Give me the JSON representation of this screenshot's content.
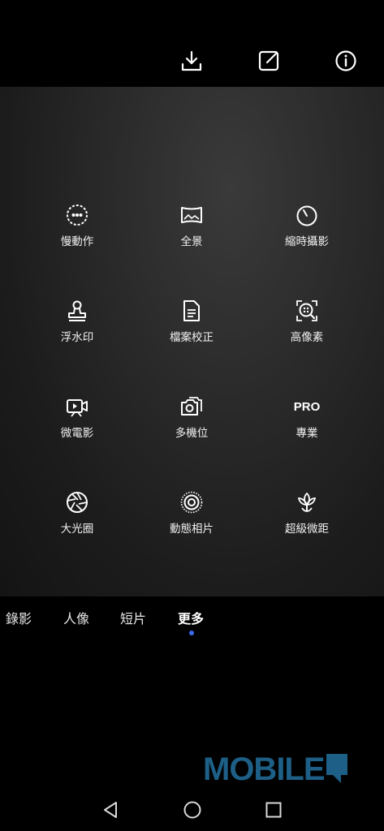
{
  "top_actions": {
    "download_icon": "download-icon",
    "edit_icon": "edit-icon",
    "info_icon": "info-icon"
  },
  "modes": [
    {
      "label": "慢動作",
      "icon": "slow-motion-icon"
    },
    {
      "label": "全景",
      "icon": "panorama-icon"
    },
    {
      "label": "縮時攝影",
      "icon": "timelapse-icon"
    },
    {
      "label": "浮水印",
      "icon": "watermark-stamp-icon"
    },
    {
      "label": "檔案校正",
      "icon": "document-icon"
    },
    {
      "label": "高像素",
      "icon": "high-res-icon"
    },
    {
      "label": "微電影",
      "icon": "movie-icon"
    },
    {
      "label": "多機位",
      "icon": "multi-camera-icon"
    },
    {
      "label": "專業",
      "icon": "pro-icon",
      "badge": "PRO"
    },
    {
      "label": "大光圈",
      "icon": "aperture-icon"
    },
    {
      "label": "動態相片",
      "icon": "moving-picture-icon"
    },
    {
      "label": "超級微距",
      "icon": "macro-flower-icon"
    }
  ],
  "tabs": [
    {
      "label": "錄影"
    },
    {
      "label": "人像"
    },
    {
      "label": "短片"
    },
    {
      "label": "更多",
      "active": true
    }
  ],
  "accent_color": "#3a6cf0",
  "watermark_text": "MOBILE",
  "nav": {
    "back": "back-icon",
    "home": "home-icon",
    "recents": "recents-icon"
  }
}
